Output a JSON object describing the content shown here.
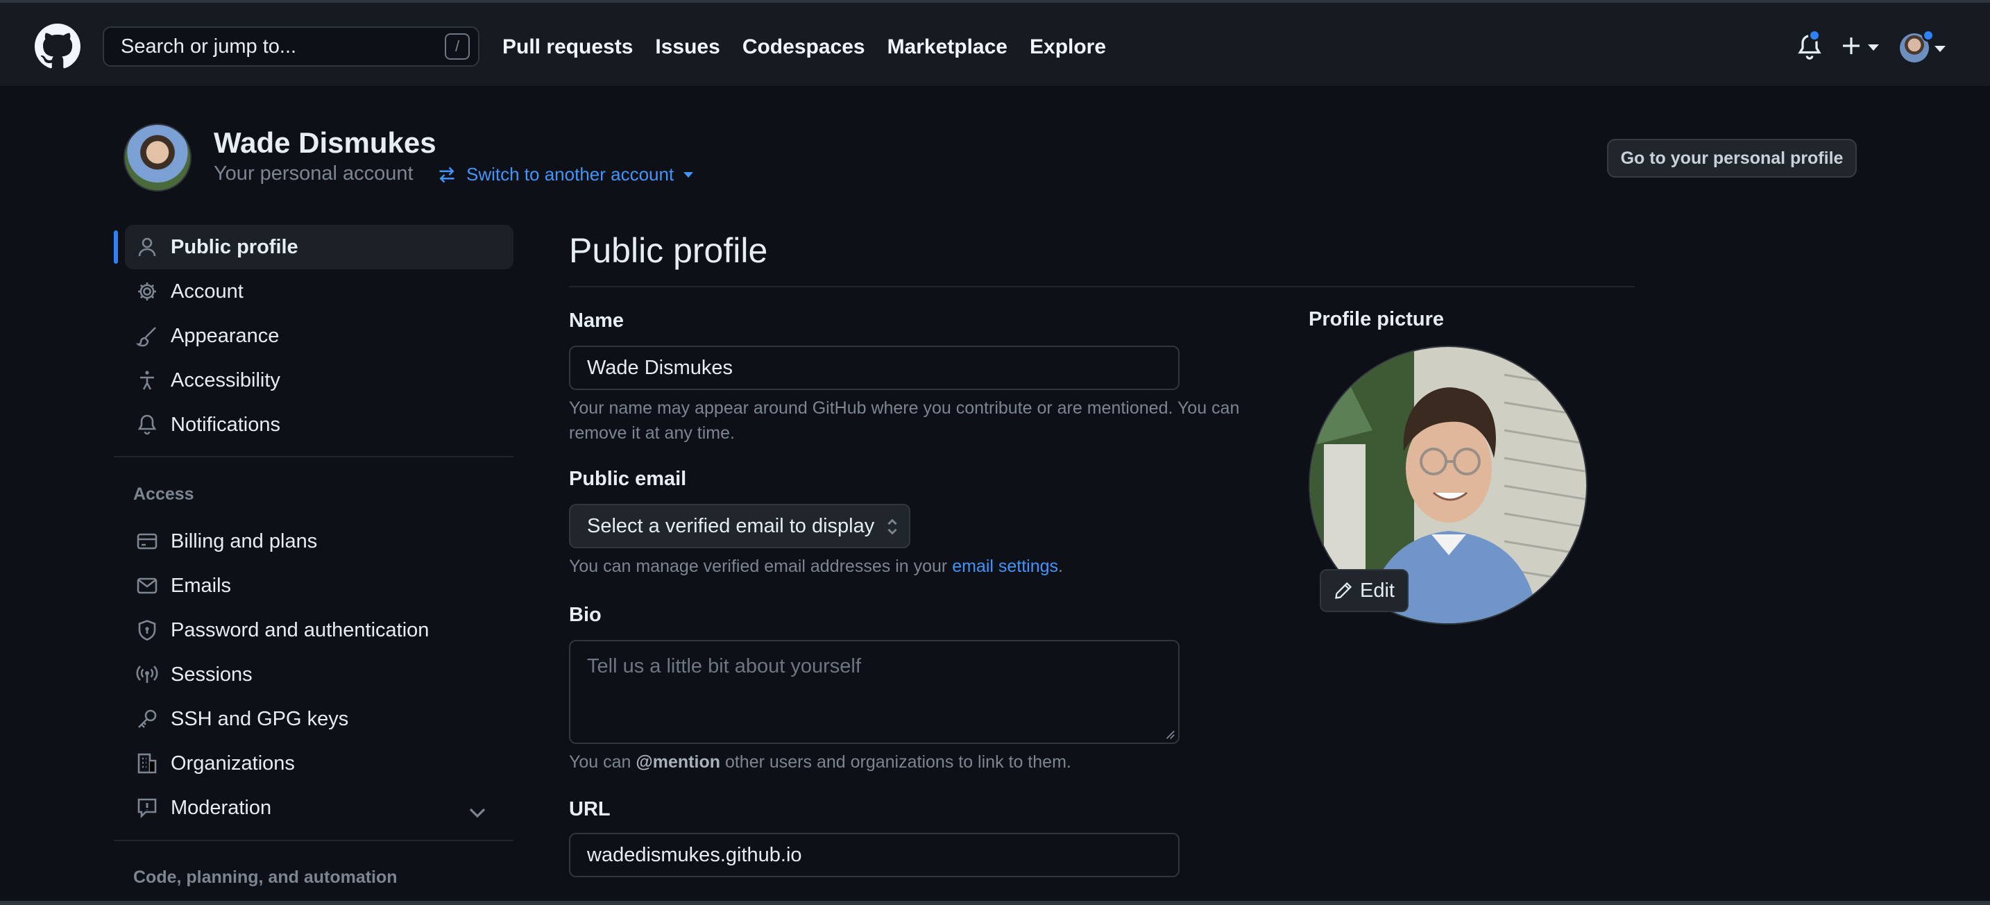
{
  "header": {
    "search_placeholder": "Search or jump to...",
    "search_shortcut": "/",
    "nav": [
      "Pull requests",
      "Issues",
      "Codespaces",
      "Marketplace",
      "Explore"
    ]
  },
  "account": {
    "name": "Wade Dismukes",
    "subtitle": "Your personal account",
    "switch_label": "Switch to another account",
    "profile_button": "Go to your personal profile"
  },
  "sidebar": {
    "items": [
      {
        "label": "Public profile",
        "icon": "person-icon"
      },
      {
        "label": "Account",
        "icon": "gear-icon"
      },
      {
        "label": "Appearance",
        "icon": "paintbrush-icon"
      },
      {
        "label": "Accessibility",
        "icon": "accessibility-icon"
      },
      {
        "label": "Notifications",
        "icon": "bell-icon"
      }
    ],
    "access_heading": "Access",
    "access_items": [
      {
        "label": "Billing and plans",
        "icon": "credit-card-icon"
      },
      {
        "label": "Emails",
        "icon": "mail-icon"
      },
      {
        "label": "Password and authentication",
        "icon": "shield-lock-icon"
      },
      {
        "label": "Sessions",
        "icon": "broadcast-icon"
      },
      {
        "label": "SSH and GPG keys",
        "icon": "key-icon"
      },
      {
        "label": "Organizations",
        "icon": "organization-icon"
      },
      {
        "label": "Moderation",
        "icon": "report-icon"
      }
    ],
    "code_heading": "Code, planning, and automation"
  },
  "main": {
    "title": "Public profile",
    "name_label": "Name",
    "name_value": "Wade Dismukes",
    "name_note_1": "Your name may appear around GitHub where you contribute or are mentioned. You can",
    "name_note_2": "remove it at any time.",
    "email_label": "Public email",
    "email_select": "Select a verified email to display",
    "email_note_prefix": "You can manage verified email addresses in your ",
    "email_note_link": "email settings",
    "email_note_suffix": ".",
    "bio_label": "Bio",
    "bio_placeholder": "Tell us a little bit about yourself",
    "bio_note_prefix": "You can ",
    "bio_note_mention": "@mention",
    "bio_note_suffix": " other users and organizations to link to them.",
    "url_label": "URL",
    "url_value": "wadedismukes.github.io",
    "picture_label": "Profile picture",
    "edit_label": "Edit"
  },
  "colors": {
    "background": "#0d1117",
    "header": "#161b22",
    "accent": "#2f81f7",
    "link": "#4493f8"
  }
}
